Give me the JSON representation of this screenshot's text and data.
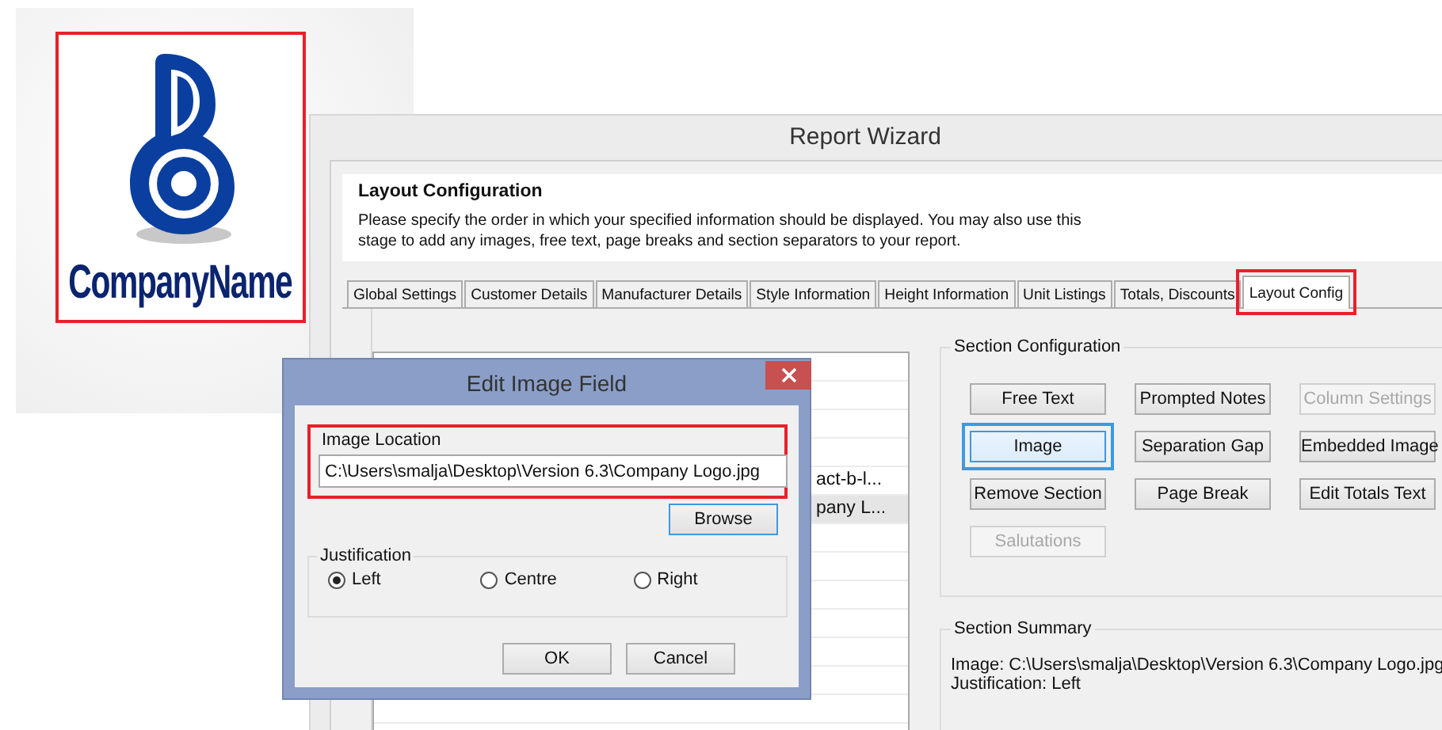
{
  "logo": {
    "name": "CompanyName",
    "highlighted": true
  },
  "window": {
    "title": "Report Wizard"
  },
  "header": {
    "title": "Layout Configuration",
    "description": "Please specify the order in which your specified information should be displayed.  You may also use this\nstage to add any images, free text, page breaks and section separators to your report."
  },
  "tabs": [
    {
      "label": "Global Settings",
      "selected": false,
      "highlighted": false
    },
    {
      "label": "Customer Details",
      "selected": false,
      "highlighted": false
    },
    {
      "label": "Manufacturer Details",
      "selected": false,
      "highlighted": false
    },
    {
      "label": "Style Information",
      "selected": false,
      "highlighted": false
    },
    {
      "label": "Height Information",
      "selected": false,
      "highlighted": false
    },
    {
      "label": "Unit Listings",
      "selected": false,
      "highlighted": false
    },
    {
      "label": "Totals, Discounts",
      "selected": false,
      "highlighted": false
    },
    {
      "label": "Layout Config",
      "selected": true,
      "highlighted": true
    }
  ],
  "list": {
    "rows": [
      {
        "text": "act-b-l...",
        "selected": false
      },
      {
        "text": "pany L...",
        "selected": true
      }
    ]
  },
  "section_configuration": {
    "title": "Section Configuration",
    "buttons": [
      {
        "label": "Free Text",
        "disabled": false,
        "focused": false,
        "highlighted": false
      },
      {
        "label": "Prompted Notes",
        "disabled": false,
        "focused": false,
        "highlighted": false
      },
      {
        "label": "Column Settings",
        "disabled": true,
        "focused": false,
        "highlighted": false
      },
      {
        "label": "Image",
        "disabled": false,
        "focused": true,
        "highlighted": true
      },
      {
        "label": "Separation Gap",
        "disabled": false,
        "focused": false,
        "highlighted": false
      },
      {
        "label": "Embedded Image",
        "disabled": false,
        "focused": false,
        "highlighted": false
      },
      {
        "label": "Remove Section",
        "disabled": false,
        "focused": false,
        "highlighted": false
      },
      {
        "label": "Page Break",
        "disabled": false,
        "focused": false,
        "highlighted": false
      },
      {
        "label": "Edit Totals Text",
        "disabled": false,
        "focused": false,
        "highlighted": false
      },
      {
        "label": "Salutations",
        "disabled": true,
        "focused": false,
        "highlighted": false
      }
    ]
  },
  "section_summary": {
    "title": "Section Summary",
    "lines": [
      "Image: C:\\Users\\smalja\\Desktop\\Version 6.3\\Company Logo.jpg",
      "Justification: Left"
    ]
  },
  "dialog": {
    "title": "Edit Image Field",
    "image_location": {
      "label": "Image Location",
      "value": "C:\\Users\\smalja\\Desktop\\Version 6.3\\Company Logo.jpg",
      "highlighted": true
    },
    "browse": "Browse",
    "justification": {
      "label": "Justification",
      "options": [
        {
          "label": "Left",
          "selected": true
        },
        {
          "label": "Centre",
          "selected": false
        },
        {
          "label": "Right",
          "selected": false
        }
      ]
    },
    "buttons": [
      "OK",
      "Cancel"
    ]
  }
}
